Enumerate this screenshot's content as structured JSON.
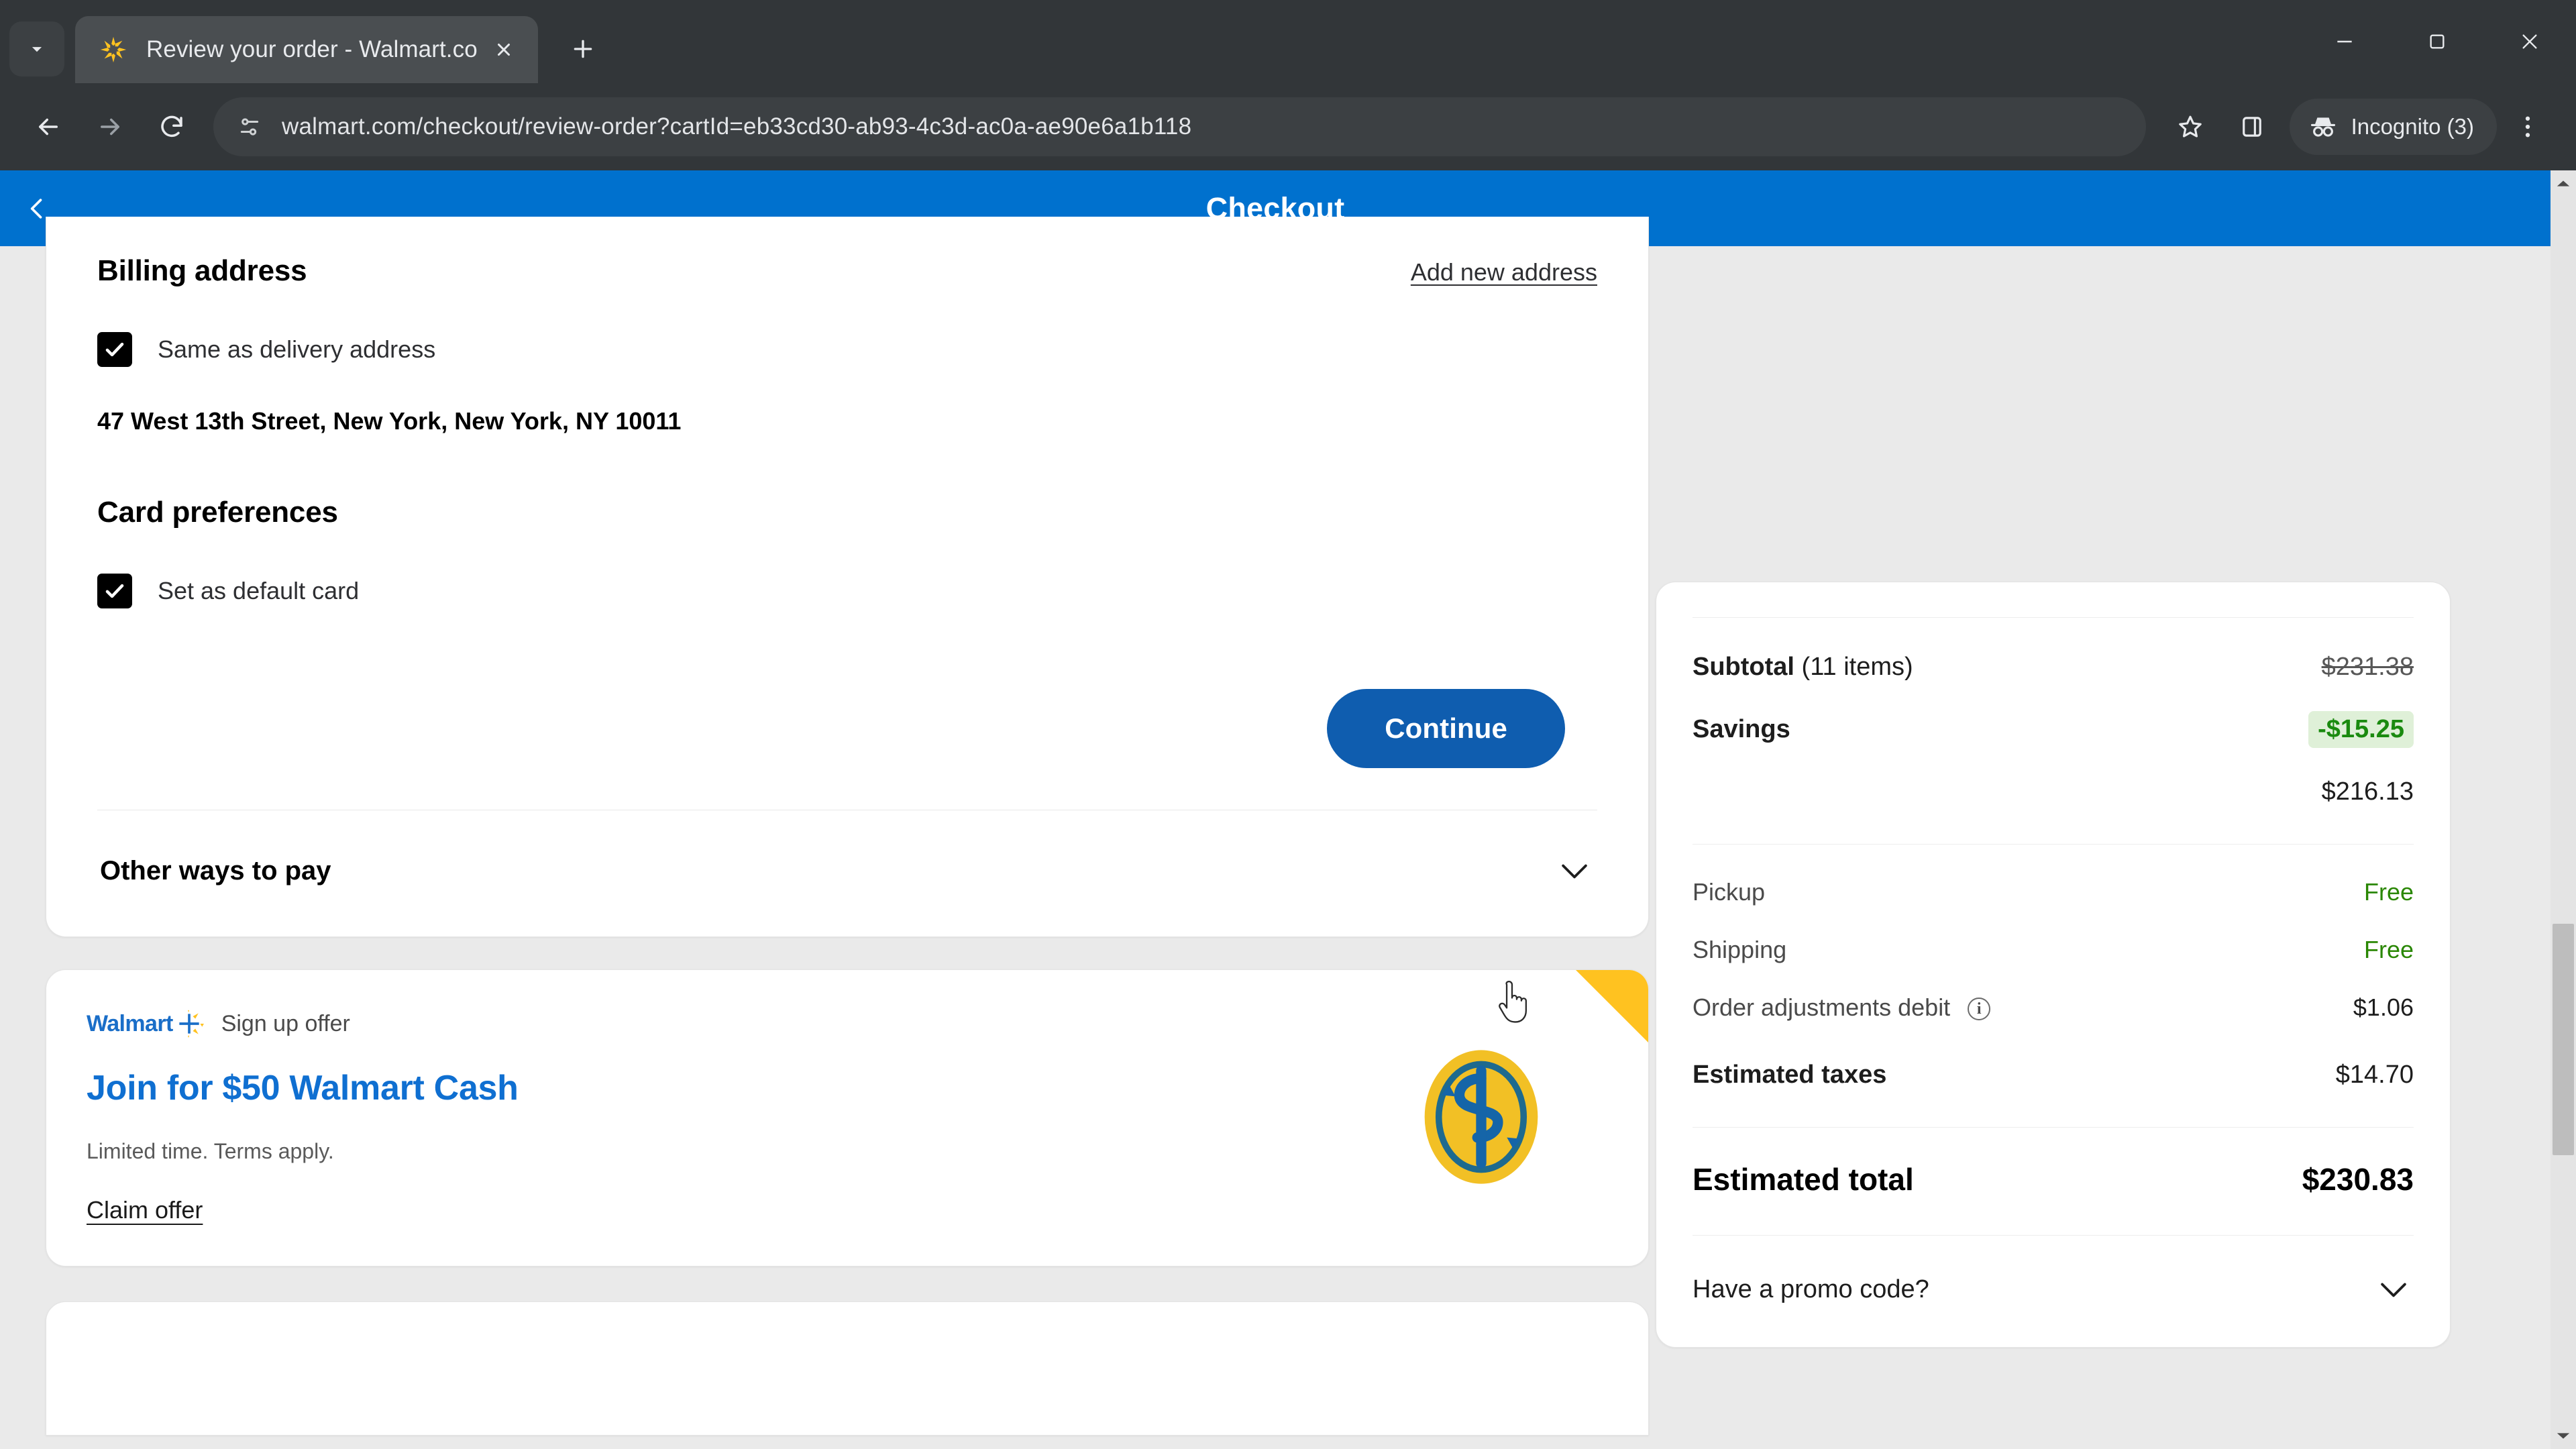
{
  "browser": {
    "tab": {
      "title": "Review your order - Walmart.co",
      "favicon_name": "walmart-spark-favicon"
    },
    "new_tab_label": "+",
    "window_controls": {
      "minimize": "minimize",
      "maximize": "maximize",
      "close": "close"
    },
    "toolbar": {
      "back": "back",
      "forward": "forward",
      "reload": "reload",
      "url": "walmart.com/checkout/review-order?cartId=eb33cd30-ab93-4c3d-ac0a-ae90e6a1b118",
      "bookmark": "bookmark",
      "side_panel": "side-panel",
      "profile_label": "Incognito (3)",
      "menu": "menu"
    }
  },
  "page": {
    "header": {
      "title": "Checkout",
      "back": "back"
    },
    "billing": {
      "section_title": "Billing address",
      "add_new_link": "Add new address",
      "same_as_delivery_label": "Same as delivery address",
      "same_as_delivery_checked": true,
      "address": "47 West 13th Street, New York, New York, NY 10011"
    },
    "card_preferences": {
      "section_title": "Card preferences",
      "set_default_label": "Set as default card",
      "set_default_checked": true
    },
    "continue_button": "Continue",
    "other_ways": {
      "label": "Other ways to pay",
      "expanded": false
    },
    "promo_card": {
      "brand": "Walmart",
      "kicker": "Sign up offer",
      "title": "Join for $50 Walmart Cash",
      "subtitle": "Limited time. Terms apply.",
      "claim_link": "Claim offer"
    },
    "summary": {
      "subtotal_label": "Subtotal",
      "subtotal_items": "(11 items)",
      "subtotal_value": "$231.38",
      "savings_label": "Savings",
      "savings_value": "-$15.25",
      "after_savings_value": "$216.13",
      "pickup_label": "Pickup",
      "pickup_value": "Free",
      "shipping_label": "Shipping",
      "shipping_value": "Free",
      "adjustments_label": "Order adjustments debit",
      "adjustments_value": "$1.06",
      "taxes_label": "Estimated taxes",
      "taxes_value": "$14.70",
      "total_label": "Estimated total",
      "total_value": "$230.83",
      "promo_label": "Have a promo code?"
    }
  },
  "colors": {
    "walmart_blue": "#0071ce",
    "continue_blue": "#0f5daf",
    "savings_green": "#1a8a0f",
    "free_green": "#2a8703",
    "walmart_yellow": "#ffc220",
    "promo_title_blue": "#0f6fd1"
  }
}
